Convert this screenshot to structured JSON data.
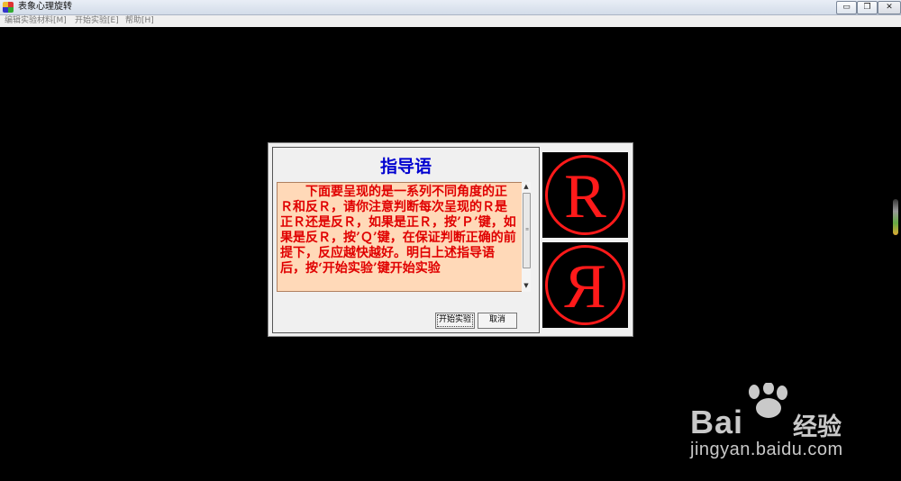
{
  "window": {
    "title": "表象心理旋转",
    "minimize_label": "▭",
    "restore_label": "❐",
    "close_label": "✕"
  },
  "menu": [
    {
      "label": "编辑实验材料[M]"
    },
    {
      "label": "开始实验[E]"
    },
    {
      "label": "帮助[H]"
    }
  ],
  "dialog": {
    "heading": "指导语",
    "instruction": "下面要呈现的是一系列不同角度的正Ｒ和反Ｒ，请你注意判断每次呈现的Ｒ是正Ｒ还是反Ｒ，如果是正Ｒ，按’Ｐ’键，如果是反Ｒ，按’Ｑ’键，在保证判断正确的前提下，反应越快越好。明白上述指导语后，按‘开始实验’键开始实验",
    "start_button": "开始实验",
    "cancel_button": "取消"
  },
  "figures": {
    "normal_letter": "R",
    "mirrored_letter": "Я",
    "color": "#ff1a1a"
  },
  "watermark": {
    "brand": "Bai",
    "brand_tail": "经验",
    "url": "jingyan.baidu.com"
  }
}
